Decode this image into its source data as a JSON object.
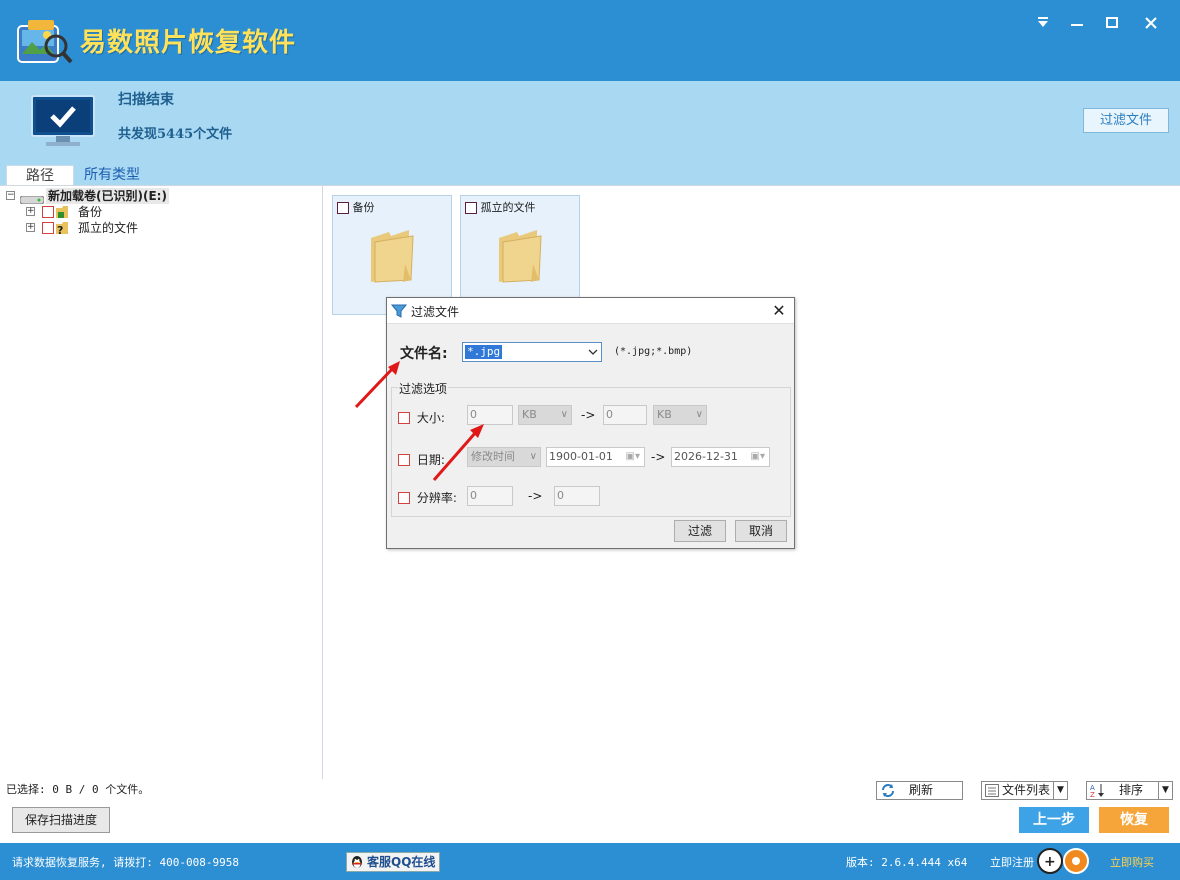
{
  "app": {
    "title": "易数照片恢复软件"
  },
  "header": {
    "scan_status": "扫描结束",
    "found_text": "共发现5445个文件",
    "filter_button": "过滤文件"
  },
  "tabs": [
    "路径",
    "所有类型"
  ],
  "tree": {
    "root_label": "新加载卷(已识别)(E:)",
    "children": [
      "备份",
      "孤立的文件"
    ]
  },
  "folders": [
    "备份",
    "孤立的文件"
  ],
  "dialog": {
    "title": "过滤文件",
    "filename_label": "文件名:",
    "filename_value": "*.jpg",
    "ext_hint": "(*.jpg;*.bmp)",
    "group_label": "过滤选项",
    "size_label": "大小:",
    "size_min": "0",
    "size_unit_1": "KB",
    "size_arrow": "->",
    "size_max": "0",
    "size_unit_2": "KB",
    "date_label": "日期:",
    "date_type": "修改时间",
    "date_from": "1900-01-01",
    "date_arrow": "->",
    "date_to": "2026-12-31",
    "res_label": "分辨率:",
    "res_min": "0",
    "res_arrow": "->",
    "res_max": "0",
    "ok_button": "过滤",
    "cancel_button": "取消"
  },
  "toolbar": {
    "selection_info": "已选择: 0 B / 0 个文件。",
    "refresh": "刷新",
    "file_list": "文件列表",
    "sort": "排序",
    "save_progress": "保存扫描进度",
    "prev": "上一步",
    "restore": "恢复"
  },
  "footer": {
    "service": "请求数据恢复服务, 请拨打: 400-008-9958",
    "qq": "客服QQ在线",
    "version": "版本: 2.6.4.444 x64",
    "register": "立即注册",
    "buy": "立即购买"
  },
  "colors": {
    "titlebar": "#2c8fd4",
    "header_bg": "#a8d8f2",
    "prev_button": "#3ea3e6",
    "restore_button": "#f6a53a",
    "annotation_arrow": "#e01818"
  }
}
